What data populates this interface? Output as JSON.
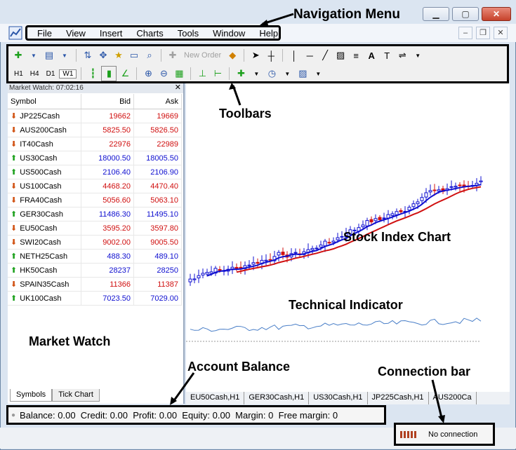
{
  "menu": [
    "File",
    "View",
    "Insert",
    "Charts",
    "Tools",
    "Window",
    "Help"
  ],
  "window_controls": [
    "minimize",
    "maximize",
    "close"
  ],
  "toolbar": {
    "new_order": "New Order",
    "timeframes": [
      "H1",
      "H4",
      "D1",
      "W1"
    ]
  },
  "market_watch": {
    "title": "Market Watch: 07:02:16",
    "headers": [
      "Symbol",
      "Bid",
      "Ask"
    ],
    "rows": [
      {
        "symbol": "JP225Cash",
        "bid": "19662",
        "ask": "19669",
        "dir": "down"
      },
      {
        "symbol": "AUS200Cash",
        "bid": "5825.50",
        "ask": "5826.50",
        "dir": "down"
      },
      {
        "symbol": "IT40Cash",
        "bid": "22976",
        "ask": "22989",
        "dir": "down"
      },
      {
        "symbol": "US30Cash",
        "bid": "18000.50",
        "ask": "18005.50",
        "dir": "up"
      },
      {
        "symbol": "US500Cash",
        "bid": "2106.40",
        "ask": "2106.90",
        "dir": "up"
      },
      {
        "symbol": "US100Cash",
        "bid": "4468.20",
        "ask": "4470.40",
        "dir": "down"
      },
      {
        "symbol": "FRA40Cash",
        "bid": "5056.60",
        "ask": "5063.10",
        "dir": "down"
      },
      {
        "symbol": "GER30Cash",
        "bid": "11486.30",
        "ask": "11495.10",
        "dir": "up"
      },
      {
        "symbol": "EU50Cash",
        "bid": "3595.20",
        "ask": "3597.80",
        "dir": "down"
      },
      {
        "symbol": "SWI20Cash",
        "bid": "9002.00",
        "ask": "9005.50",
        "dir": "down"
      },
      {
        "symbol": "NETH25Cash",
        "bid": "488.30",
        "ask": "489.10",
        "dir": "up"
      },
      {
        "symbol": "HK50Cash",
        "bid": "28237",
        "ask": "28250",
        "dir": "up"
      },
      {
        "symbol": "SPAIN35Cash",
        "bid": "11366",
        "ask": "11387",
        "dir": "down"
      },
      {
        "symbol": "UK100Cash",
        "bid": "7023.50",
        "ask": "7029.00",
        "dir": "up"
      }
    ],
    "tabs": [
      "Symbols",
      "Tick Chart"
    ]
  },
  "chart_tabs": [
    "EU50Cash,H1",
    "GER30Cash,H1",
    "US30Cash,H1",
    "JP225Cash,H1",
    "AUS200Ca"
  ],
  "balance": {
    "text": "Balance: 0.00  Credit: 0.00  Profit: 0.00  Equity: 0.00  Margin: 0  Free margin: 0"
  },
  "connection": {
    "text": "No connection"
  },
  "annotations": {
    "navigation_menu": "Navigation Menu",
    "toolbars": "Toolbars",
    "stock_index_chart": "Stock Index Chart",
    "technical_indicator": "Technical Indicator",
    "market_watch": "Market Watch",
    "account_balance": "Account Balance",
    "connection_bar": "Connection bar"
  },
  "colors": {
    "bull": "#1010d0",
    "bear": "#d01010",
    "ma_fast": "#1010d0",
    "ma_slow": "#d01010",
    "indicator": "#4a7fc8"
  }
}
